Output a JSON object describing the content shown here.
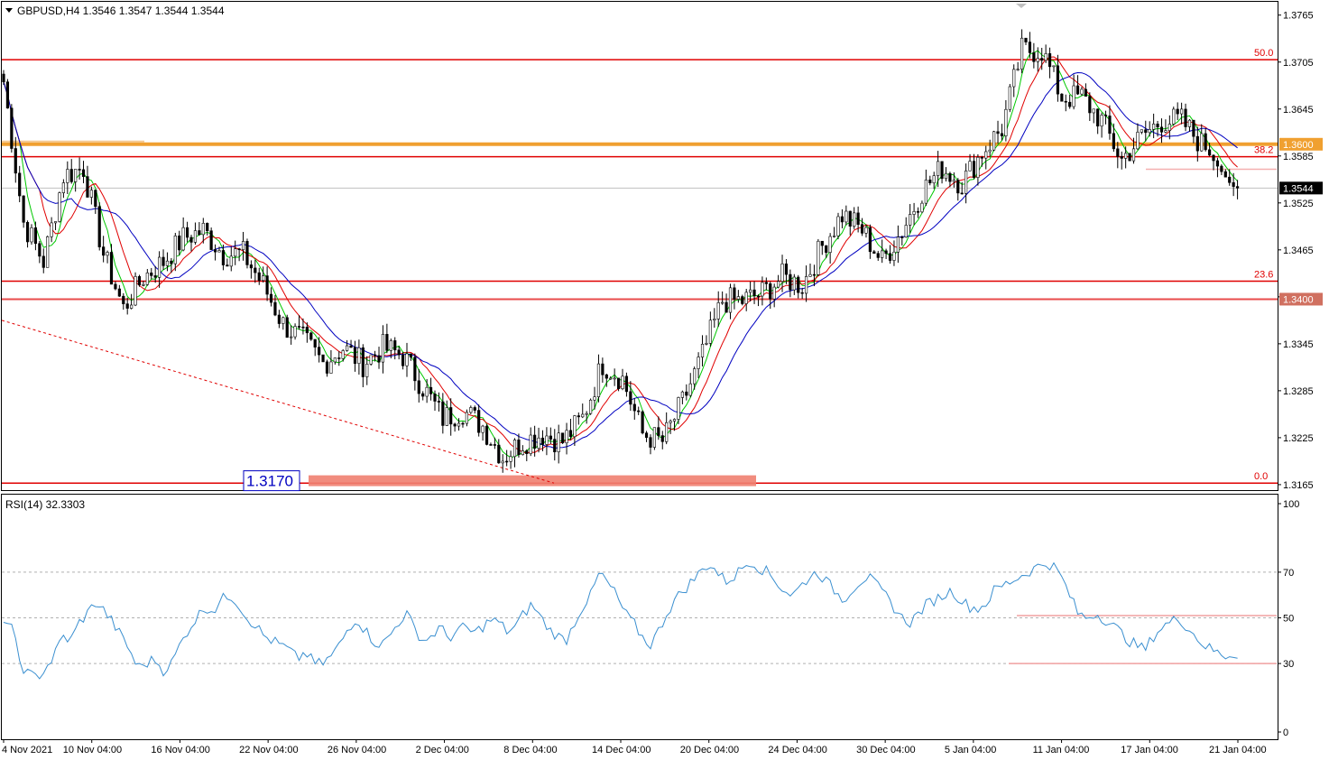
{
  "header": {
    "symbol_info": "GBPUSD,H4  1.3546 1.3547 1.3544 1.3544"
  },
  "rsi_panel": {
    "title": "RSI(14) 32.3303"
  },
  "colors": {
    "background": "#ffffff",
    "frame": "#000000",
    "candle": "#000000",
    "ma_fast": "#00c800",
    "ma_mid": "#e00000",
    "ma_slow": "#0000c0",
    "level_line": "#e00000",
    "key_level": "#f0a030",
    "support_zone": "#f08070",
    "trendline": "#e00000",
    "rsi_line": "#3a8fd0",
    "rsi_guides": "#f0a0a0"
  },
  "chart_data": [
    {
      "type": "candlestick",
      "title": "GBPUSD,H4",
      "ohlc_last": {
        "open": 1.3546,
        "high": 1.3547,
        "low": 1.3544,
        "close": 1.3544
      },
      "x_tick_labels": [
        "4 Nov 2021",
        "10 Nov 04:00",
        "16 Nov 04:00",
        "22 Nov 04:00",
        "26 Nov 04:00",
        "2 Dec 04:00",
        "8 Dec 04:00",
        "14 Dec 04:00",
        "20 Dec 04:00",
        "24 Dec 04:00",
        "30 Dec 04:00",
        "5 Jan 04:00",
        "11 Jan 04:00",
        "17 Jan 04:00",
        "21 Jan 04:00"
      ],
      "y_tick_labels": [
        "1.3765",
        "1.3705",
        "1.3645",
        "1.3585",
        "1.3525",
        "1.3465",
        "1.3405",
        "1.3345",
        "1.3285",
        "1.3225",
        "1.3165"
      ],
      "ylim": [
        1.3158,
        1.3782
      ],
      "price_path": [
        [
          0,
          1.368
        ],
        [
          5,
          1.35
        ],
        [
          10,
          1.345
        ],
        [
          15,
          1.356
        ],
        [
          20,
          1.357
        ],
        [
          25,
          1.346
        ],
        [
          30,
          1.339
        ],
        [
          35,
          1.343
        ],
        [
          40,
          1.345
        ],
        [
          45,
          1.348
        ],
        [
          50,
          1.349
        ],
        [
          55,
          1.346
        ],
        [
          60,
          1.346
        ],
        [
          65,
          1.342
        ],
        [
          70,
          1.337
        ],
        [
          75,
          1.335
        ],
        [
          80,
          1.332
        ],
        [
          85,
          1.334
        ],
        [
          90,
          1.332
        ],
        [
          95,
          1.334
        ],
        [
          100,
          1.333
        ],
        [
          105,
          1.329
        ],
        [
          110,
          1.325
        ],
        [
          115,
          1.326
        ],
        [
          120,
          1.324
        ],
        [
          125,
          1.32
        ],
        [
          130,
          1.322
        ],
        [
          135,
          1.323
        ],
        [
          140,
          1.322
        ],
        [
          145,
          1.325
        ],
        [
          150,
          1.332
        ],
        [
          155,
          1.33
        ],
        [
          160,
          1.323
        ],
        [
          165,
          1.322
        ],
        [
          170,
          1.327
        ],
        [
          175,
          1.333
        ],
        [
          180,
          1.34
        ],
        [
          185,
          1.34
        ],
        [
          190,
          1.341
        ],
        [
          195,
          1.343
        ],
        [
          200,
          1.342
        ],
        [
          205,
          1.347
        ],
        [
          210,
          1.351
        ],
        [
          215,
          1.349
        ],
        [
          220,
          1.345
        ],
        [
          225,
          1.349
        ],
        [
          230,
          1.354
        ],
        [
          235,
          1.357
        ],
        [
          240,
          1.355
        ],
        [
          245,
          1.359
        ],
        [
          250,
          1.362
        ],
        [
          255,
          1.372
        ],
        [
          260,
          1.372
        ],
        [
          265,
          1.366
        ],
        [
          270,
          1.366
        ],
        [
          275,
          1.363
        ],
        [
          280,
          1.358
        ],
        [
          285,
          1.361
        ],
        [
          290,
          1.363
        ],
        [
          295,
          1.363
        ],
        [
          300,
          1.36
        ],
        [
          305,
          1.3565
        ],
        [
          308,
          1.3544
        ]
      ],
      "levels": [
        {
          "label": "50.0",
          "price": 1.3708
        },
        {
          "label": "38.2",
          "price": 1.3584
        },
        {
          "label": "1.3600",
          "price": 1.36,
          "highlight": true
        },
        {
          "label": "1.3544",
          "price": 1.3544,
          "current": true
        },
        {
          "label": "23.6",
          "price": 1.3425
        },
        {
          "label": "1.3400",
          "price": 1.3402,
          "highlight": true
        },
        {
          "label": "0.0",
          "price": 1.3167
        }
      ],
      "support_zone": {
        "label": "1.3170",
        "price": 1.317
      },
      "moving_averages": [
        "fast (green)",
        "mid (red)",
        "slow (blue)"
      ]
    },
    {
      "type": "line",
      "title": "RSI(14) 32.3303",
      "value_last": 32.3303,
      "ylim": [
        0,
        100
      ],
      "y_tick_labels": [
        "100",
        "70",
        "50",
        "30",
        "0"
      ],
      "guides": [
        70,
        50,
        30
      ],
      "values": [
        50,
        45,
        30,
        25,
        24,
        28,
        33,
        42,
        40,
        48,
        52,
        57,
        53,
        48,
        42,
        36,
        28,
        30,
        32,
        27,
        30,
        38,
        45,
        50,
        55,
        53,
        58,
        60,
        56,
        50,
        47,
        42,
        40,
        38,
        36,
        32,
        35,
        30,
        30,
        33,
        38,
        45,
        50,
        45,
        40,
        38,
        42,
        48,
        52,
        45,
        40,
        42,
        46,
        41,
        44,
        46,
        43,
        46,
        49,
        48,
        44,
        46,
        52,
        56,
        50,
        45,
        42,
        40,
        48,
        55,
        60,
        70,
        65,
        60,
        52,
        48,
        42,
        38,
        44,
        52,
        58,
        62,
        66,
        70,
        74,
        70,
        66,
        68,
        72,
        75,
        72,
        70,
        66,
        62,
        60,
        64,
        68,
        70,
        66,
        62,
        58,
        62,
        66,
        68,
        64,
        60,
        55,
        50,
        48,
        52,
        56,
        58,
        60,
        62,
        58,
        55,
        54,
        56,
        62,
        64,
        66,
        68,
        70,
        72,
        74,
        73,
        68,
        60,
        52,
        50,
        52,
        50,
        47,
        44,
        40,
        38,
        36,
        42,
        46,
        48,
        50,
        46,
        42,
        38,
        36,
        34,
        33,
        32.3
      ]
    }
  ]
}
